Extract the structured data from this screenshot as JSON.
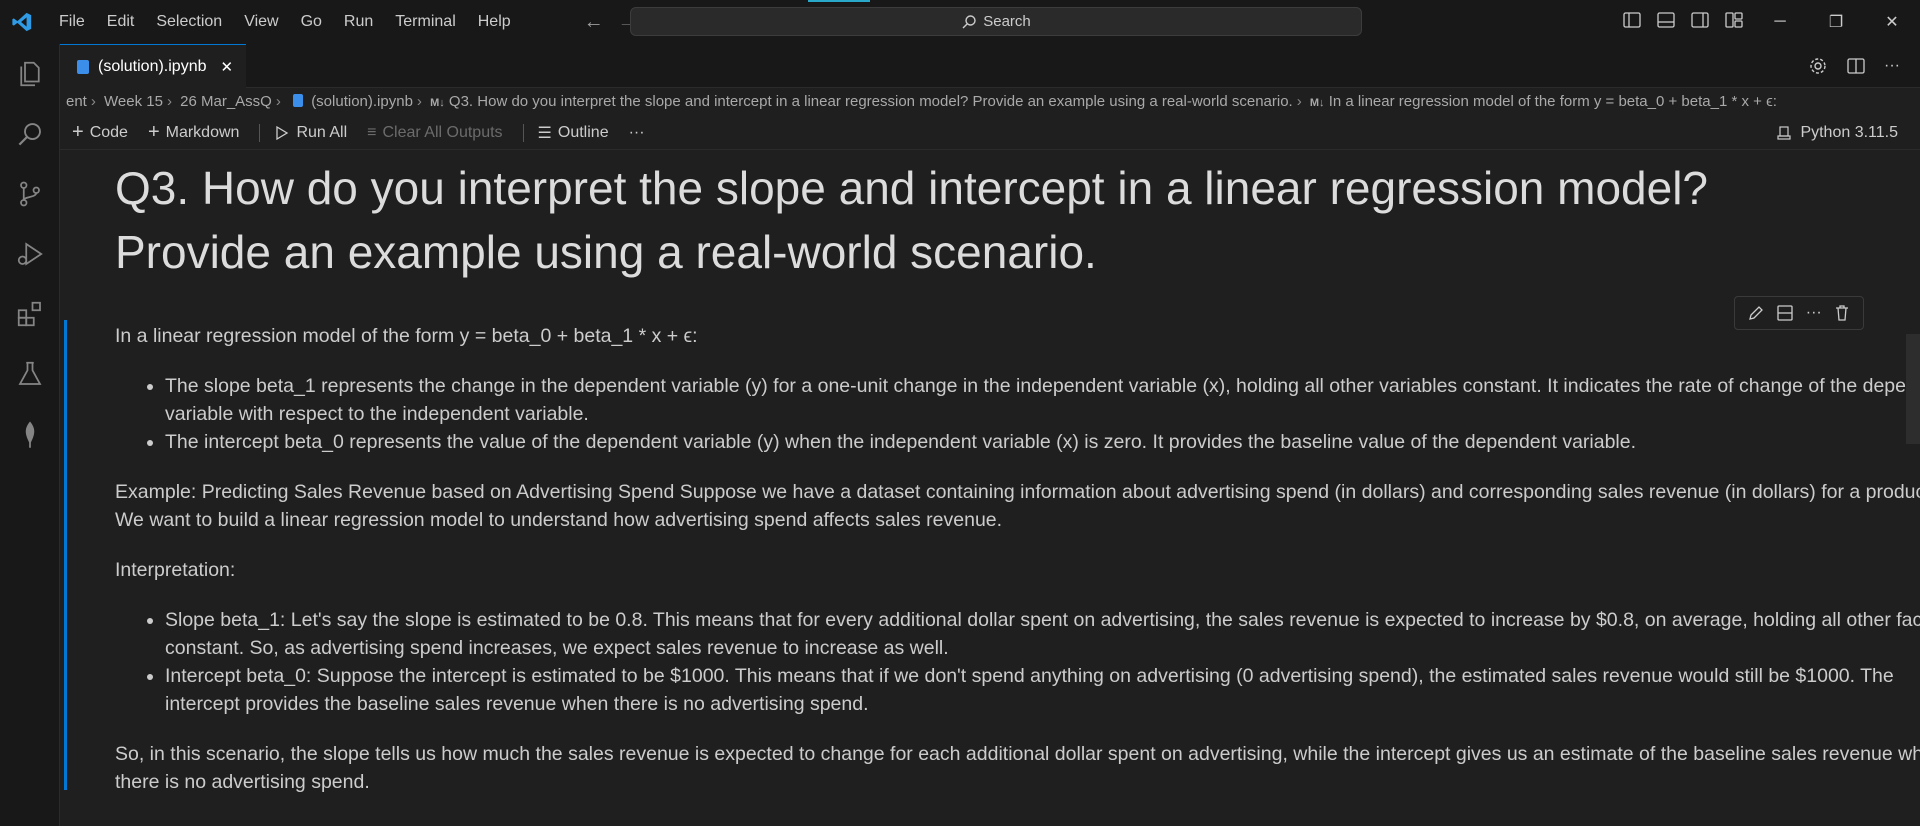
{
  "menu": [
    "File",
    "Edit",
    "Selection",
    "View",
    "Go",
    "Run",
    "Terminal",
    "Help"
  ],
  "search": {
    "label": "Search"
  },
  "tab": {
    "title": "(solution).ipynb"
  },
  "breadcrumb": {
    "items": [
      "ent",
      "Week 15",
      "26 Mar_AssQ",
      "(solution).ipynb",
      "Q3. How do you interpret the slope and intercept in a linear regression model? Provide an example using a real-world scenario.",
      "In a linear regression model of the form y = beta_0 + beta_1 * x + ϵ:"
    ]
  },
  "toolbar": {
    "code": "Code",
    "markdown": "Markdown",
    "run_all": "Run All",
    "clear_outputs": "Clear All Outputs",
    "outline": "Outline",
    "kernel": "Python 3.11.5"
  },
  "notebook": {
    "heading": "Q3. How do you interpret the slope and intercept in a linear regression model? Provide an example using a real-world scenario.",
    "intro": "In a linear regression model of the form y = beta_0 + beta_1 * x + ϵ:",
    "bullets1": [
      "The slope beta_1 represents the change in the dependent variable (y) for a one-unit change in the independent variable (x), holding all other variables constant. It indicates the rate of change of the dependent variable with respect to the independent variable.",
      "The intercept beta_0 represents the value of the dependent variable (y) when the independent variable (x) is zero. It provides the baseline value of the dependent variable."
    ],
    "example": "Example: Predicting Sales Revenue based on Advertising Spend Suppose we have a dataset containing information about advertising spend (in dollars) and corresponding sales revenue (in dollars) for a product. We want to build a linear regression model to understand how advertising spend affects sales revenue.",
    "interpretation": "Interpretation:",
    "bullets2": [
      "Slope beta_1: Let's say the slope is estimated to be 0.8. This means that for every additional dollar spent on advertising, the sales revenue is expected to increase by $0.8, on average, holding all other factors constant. So, as advertising spend increases, we expect sales revenue to increase as well.",
      "Intercept beta_0: Suppose the intercept is estimated to be $1000. This means that if we don't spend anything on advertising (0 advertising spend), the estimated sales revenue would still be $1000. The intercept provides the baseline sales revenue when there is no advertising spend."
    ],
    "conclusion": "So, in this scenario, the slope tells us how much the sales revenue is expected to change for each additional dollar spent on advertising, while the intercept gives us an estimate of the baseline sales revenue when there is no advertising spend."
  },
  "colors": {
    "accent": "#0078d4",
    "background": "#1f1f1f",
    "chrome": "#181818"
  }
}
